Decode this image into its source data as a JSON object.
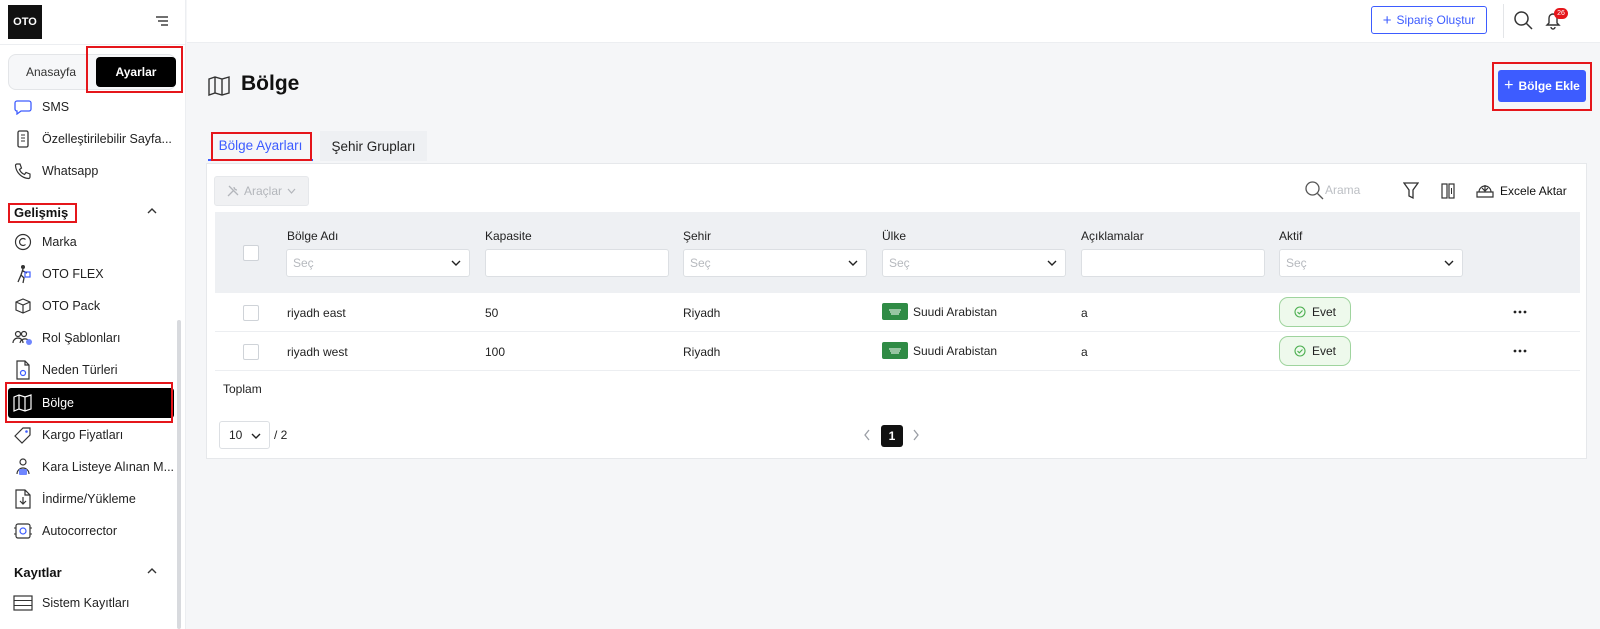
{
  "app": {
    "logo": "OTO"
  },
  "sidebar": {
    "switch": {
      "home": "Anasayfa",
      "settings": "Ayarlar"
    },
    "items_top": [
      {
        "label": "SMS",
        "icon": "sms-icon"
      },
      {
        "label": "Özelleştirilebilir Sayfa...",
        "icon": "custom-page-icon"
      },
      {
        "label": "Whatsapp",
        "icon": "phone-icon"
      }
    ],
    "section_advanced": "Gelişmiş",
    "items_advanced": [
      {
        "label": "Marka",
        "icon": "copyright-icon"
      },
      {
        "label": "OTO FLEX",
        "icon": "courier-icon"
      },
      {
        "label": "OTO Pack",
        "icon": "package-icon"
      },
      {
        "label": "Rol Şablonları",
        "icon": "users-icon"
      },
      {
        "label": "Neden Türleri",
        "icon": "document-icon"
      },
      {
        "label": "Bölge",
        "icon": "map-icon"
      },
      {
        "label": "Kargo Fiyatları",
        "icon": "price-tag-icon"
      },
      {
        "label": "Kara Listeye Alınan M...",
        "icon": "blacklist-icon"
      },
      {
        "label": "İndirme/Yükleme",
        "icon": "download-upload-icon"
      },
      {
        "label": "Autocorrector",
        "icon": "autocorrect-icon"
      }
    ],
    "section_logs": "Kayıtlar",
    "items_logs": [
      {
        "label": "Sistem Kayıtları",
        "icon": "logs-icon"
      }
    ]
  },
  "topbar": {
    "create_order": "Sipariş Oluştur",
    "notification_count": "26"
  },
  "page": {
    "title": "Bölge",
    "add_button": "Bölge Ekle",
    "tabs": [
      "Bölge Ayarları",
      "Şehir Grupları"
    ]
  },
  "toolbar": {
    "tools": "Araçlar",
    "search_placeholder": "Arama",
    "export": "Excele Aktar"
  },
  "table": {
    "columns": [
      "Bölge Adı",
      "Kapasite",
      "Şehir",
      "Ülke",
      "Açıklamalar",
      "Aktif"
    ],
    "select_placeholder": "Seç",
    "rows": [
      {
        "name": "riyadh east",
        "capacity": "50",
        "city": "Riyadh",
        "country": "Suudi Arabistan",
        "description": "a",
        "active": "Evet"
      },
      {
        "name": "riyadh west",
        "capacity": "100",
        "city": "Riyadh",
        "country": "Suudi Arabistan",
        "description": "a",
        "active": "Evet"
      }
    ],
    "total_label": "Toplam"
  },
  "pagination": {
    "page_size": "10",
    "total_pages": "/ 2",
    "current_page": "1"
  },
  "colors": {
    "accent": "#3d5cff",
    "highlight": "#e5161b",
    "active_bg": "#000000",
    "badge_green": "#9fd49e",
    "flag_green": "#2f8b45"
  }
}
